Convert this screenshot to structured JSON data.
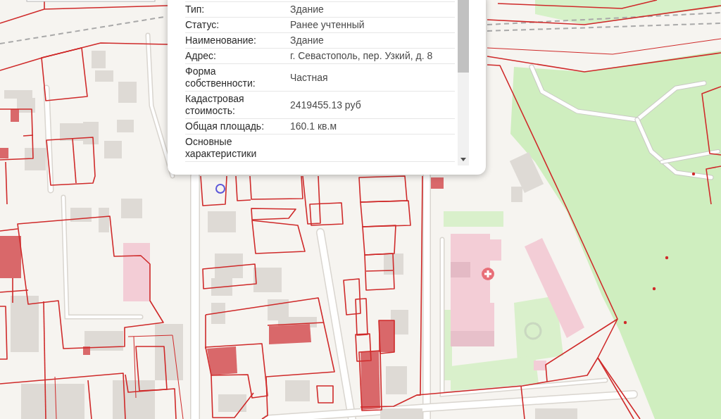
{
  "popup": {
    "rows": [
      {
        "label": "Тип:",
        "value": "Здание"
      },
      {
        "label": "Статус:",
        "value": "Ранее учтенный"
      },
      {
        "label": "Наименование:",
        "value": "Здание"
      },
      {
        "label": "Адрес:",
        "value": "г. Севастополь, пер. Узкий, д. 8"
      },
      {
        "label": "Форма собственности:",
        "value": "Частная"
      },
      {
        "label": "Кадастровая стоимость:",
        "value": "2419455.13 руб"
      },
      {
        "label": "Общая площадь:",
        "value": "160.1 кв.м"
      },
      {
        "label": "Основные характеристики"
      }
    ]
  }
}
